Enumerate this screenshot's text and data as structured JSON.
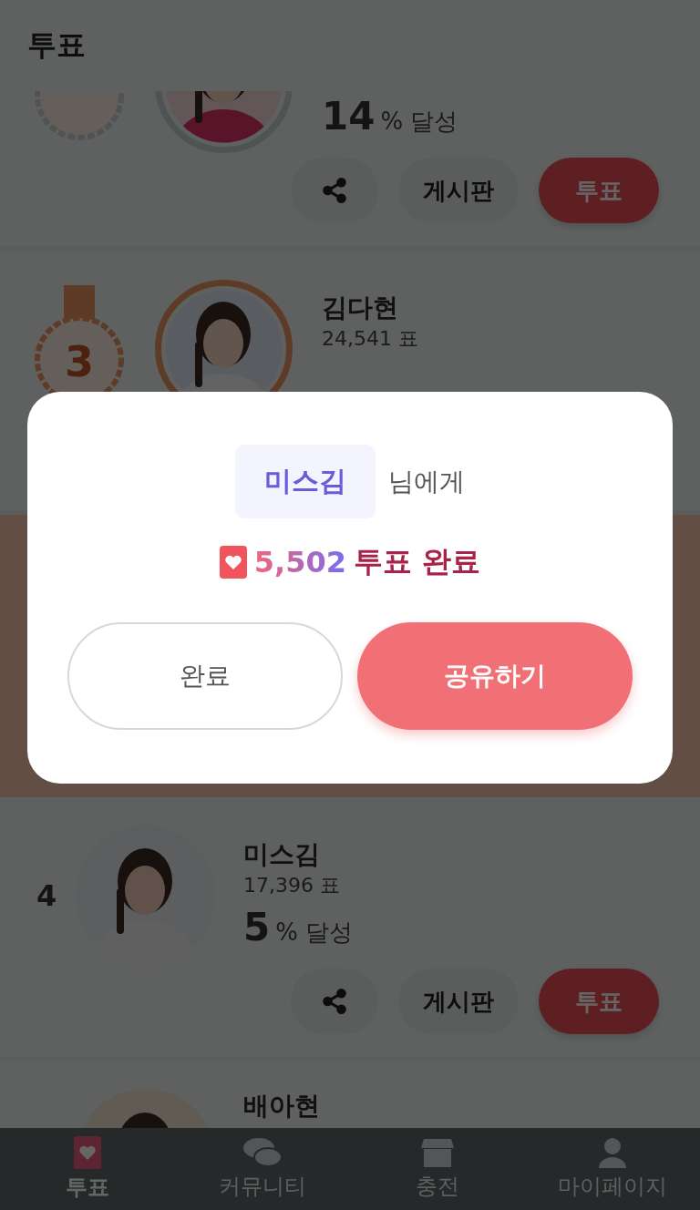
{
  "header": {
    "title": "투표"
  },
  "candidates": [
    {
      "kind": "medal",
      "achievement": {
        "value": "14",
        "unit": "% 달성"
      },
      "actions": {
        "board": "게시판",
        "vote": "투표"
      }
    },
    {
      "kind": "medal",
      "rank": "3",
      "name": "김다현",
      "votes": "24,541 표"
    },
    {
      "kind": "number",
      "rank": "4",
      "name": "미스김",
      "votes": "17,396 표",
      "achievement": {
        "value": "5",
        "unit": "% 달성"
      },
      "actions": {
        "board": "게시판",
        "vote": "투표"
      }
    },
    {
      "kind": "number",
      "name": "배아현"
    }
  ],
  "dialog": {
    "recipient": "미스김",
    "recipient_suffix": "님에게",
    "amount": "5,502",
    "result": "투표 완료",
    "buttons": [
      {
        "label": "완료",
        "kind": "outline"
      },
      {
        "label": "공유하기",
        "kind": "primary"
      }
    ]
  },
  "nav": [
    {
      "label": "투표",
      "selected": true
    },
    {
      "label": "커뮤니티",
      "selected": false
    },
    {
      "label": "충전",
      "selected": false
    },
    {
      "label": "마이페이지",
      "selected": false
    }
  ]
}
